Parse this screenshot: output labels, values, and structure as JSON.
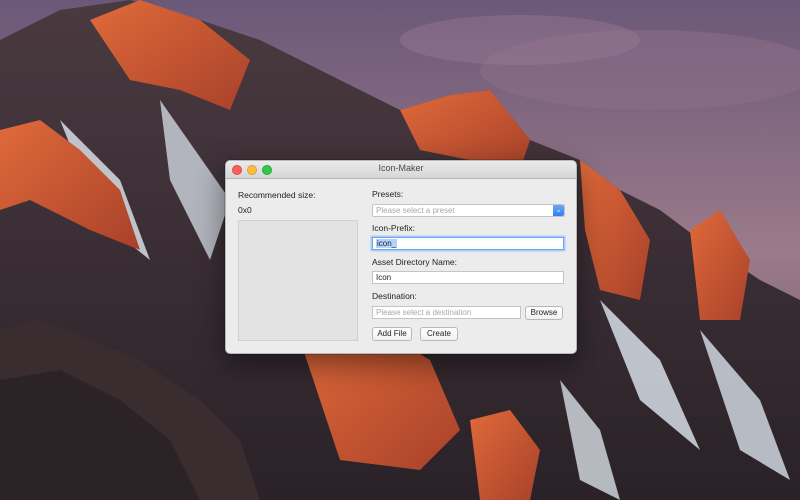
{
  "window": {
    "title": "Icon-Maker"
  },
  "left_panel": {
    "recommended_label": "Recommended size:",
    "recommended_value": "0x0"
  },
  "form": {
    "presets_label": "Presets:",
    "presets_placeholder": "Please select a preset",
    "icon_prefix_label": "Icon-Prefix:",
    "icon_prefix_value": "icon_",
    "asset_dir_label": "Asset Directory Name:",
    "asset_dir_value": "Icon",
    "destination_label": "Destination:",
    "destination_placeholder": "Please select a destination",
    "browse_label": "Browse",
    "add_file_label": "Add File",
    "create_label": "Create"
  },
  "colors": {
    "accent": "#2f7ff0",
    "window_bg": "#ececec"
  },
  "icons": [
    "close-icon",
    "minimize-icon",
    "zoom-icon",
    "chevron-down-icon"
  ]
}
